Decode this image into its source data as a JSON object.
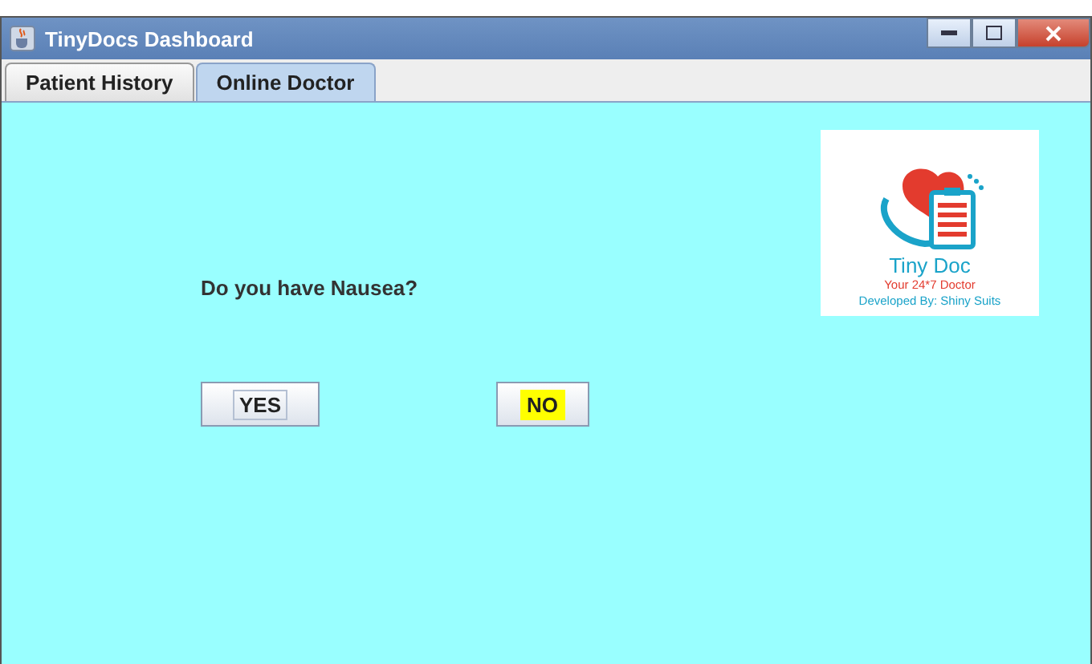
{
  "window": {
    "title": "TinyDocs Dashboard"
  },
  "tabs": [
    {
      "label": "Patient History",
      "selected": false
    },
    {
      "label": "Online Doctor",
      "selected": true
    }
  ],
  "logo": {
    "name": "Tiny Doc",
    "tagline": "Your 24*7 Doctor",
    "credit": "Developed By: Shiny Suits"
  },
  "question": "Do you have Nausea?",
  "buttons": [
    {
      "label": "YES",
      "focused": true,
      "highlighted": false
    },
    {
      "label": "NO",
      "focused": false,
      "highlighted": true
    }
  ]
}
